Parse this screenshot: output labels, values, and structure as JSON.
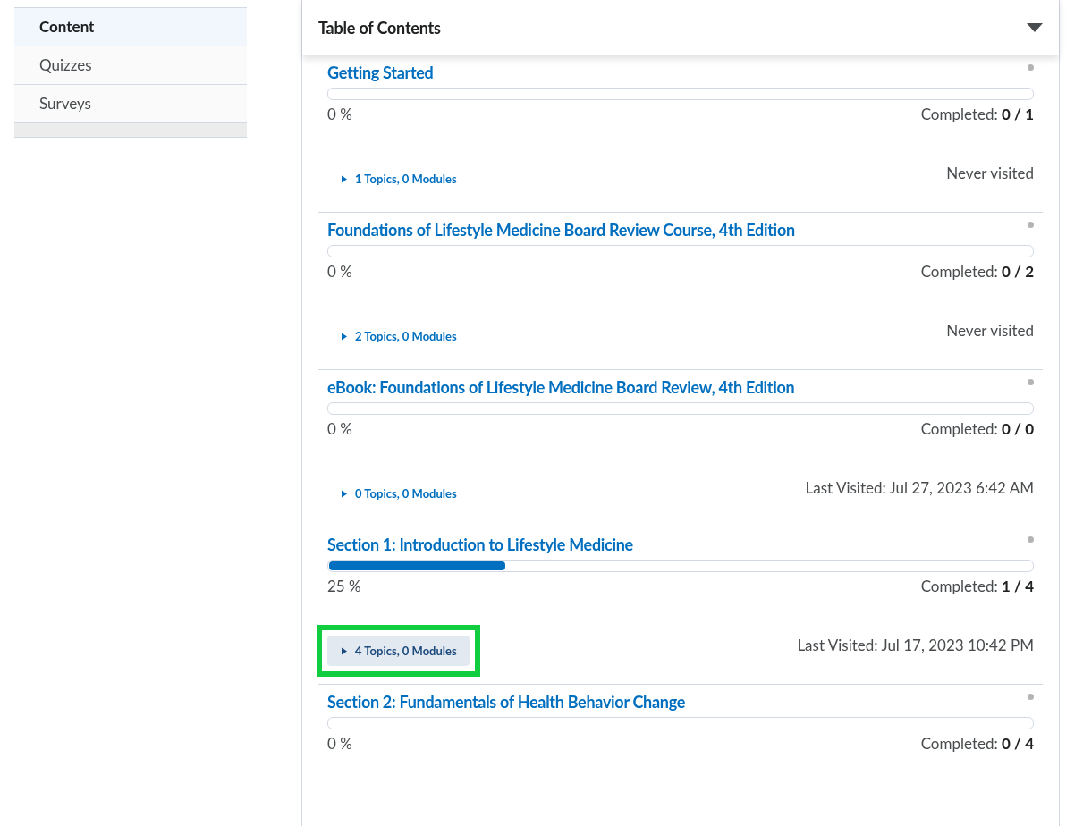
{
  "sidebar": {
    "items": [
      {
        "label": "Content",
        "selected": true
      },
      {
        "label": "Quizzes",
        "selected": false
      },
      {
        "label": "Surveys",
        "selected": false
      }
    ]
  },
  "toc": {
    "title": "Table of Contents",
    "expanded": true,
    "modules": [
      {
        "title": "Getting Started",
        "level": 0,
        "percent": "0 %",
        "completed": "Completed: **0 / 1**",
        "toggle": "1 Topics, 0 Modules",
        "highlighted": false,
        "visited": "Never visited"
      },
      {
        "title": "Foundations of Lifestyle Medicine Board Review Course, 4th Edition",
        "level": 0,
        "percent": "0 %",
        "completed": "Completed: **0 / 2**",
        "toggle": "2 Topics, 0 Modules",
        "highlighted": false,
        "visited": "Never visited"
      },
      {
        "title": "eBook: Foundations of Lifestyle Medicine Board Review, 4th Edition",
        "level": 0,
        "percent": "0 %",
        "completed": "Completed: **0 / 0**",
        "toggle": "0 Topics, 0 Modules",
        "highlighted": false,
        "visited": "Last Visited: Jul 27, 2023 6:42 AM"
      },
      {
        "title": "Section 1: Introduction to Lifestyle Medicine",
        "level": 0.25,
        "percent": "25 %",
        "completed": "Completed: **1 / 4**",
        "toggle": "4 Topics, 0 Modules",
        "highlighted": true,
        "visited": "Last Visited: Jul 17, 2023 10:42 PM"
      },
      {
        "title": "Section 2: Fundamentals of Health Behavior Change",
        "level": 0,
        "percent": "0 %",
        "completed": "Completed: **0 / 4**"
      }
    ]
  }
}
